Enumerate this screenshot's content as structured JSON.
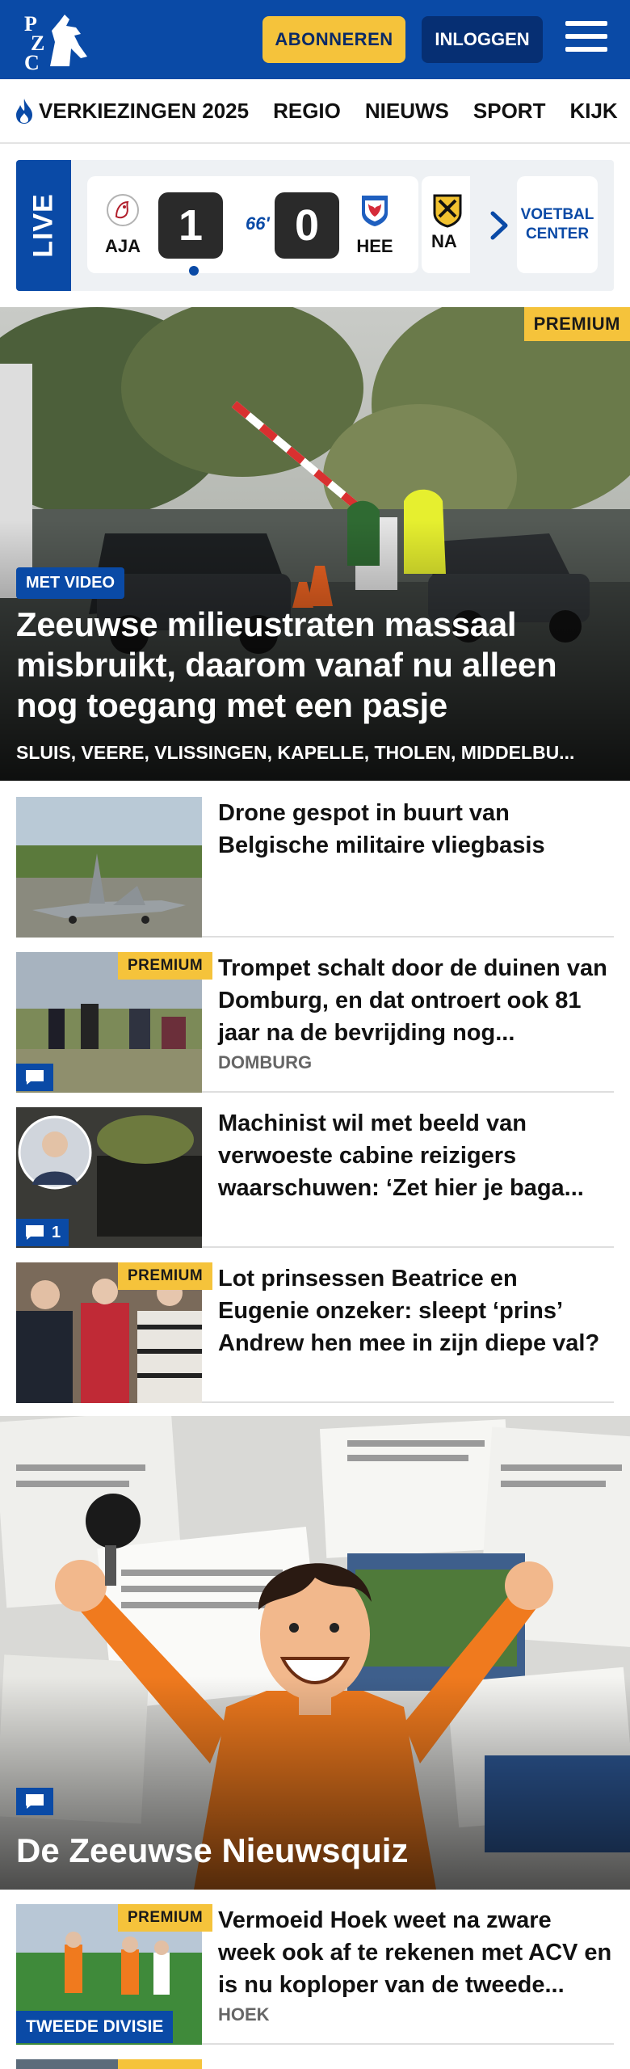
{
  "header": {
    "subscribe_label": "ABONNEREN",
    "login_label": "INLOGGEN",
    "logo_text": "PZC",
    "brand_color": "#0a4aa6",
    "accent_color": "#f5c33b"
  },
  "nav": {
    "items": [
      "VERKIEZINGEN 2025",
      "REGIO",
      "NIEUWS",
      "SPORT",
      "KIJK"
    ]
  },
  "live": {
    "label": "LIVE",
    "match": {
      "home": "AJA",
      "away": "HEE",
      "home_score": "1",
      "away_score": "0",
      "minute": "66'"
    },
    "next_team": "NA",
    "center_label_1": "VOETBAL",
    "center_label_2": "CENTER"
  },
  "hero": {
    "premium": "PREMIUM",
    "video_badge": "MET VIDEO",
    "title": "Zeeuwse milieustraten massaal misbruikt, daarom vanaf nu alleen nog toegang met een pasje",
    "tags": "SLUIS, VEERE, VLISSINGEN, KAPELLE, THOLEN, MIDDELBU..."
  },
  "articles": [
    {
      "title": "Drone gespot in buurt van Belgische militaire vliegbasis",
      "premium": "",
      "location": "",
      "comments": ""
    },
    {
      "title": "Trompet schalt door de duinen van Domburg, en dat ontroert ook 81 jaar na de bevrijding nog...",
      "premium": "PREMIUM",
      "location": "DOMBURG",
      "comments": ""
    },
    {
      "title": "Machinist wil met beeld van verwoeste cabine reizigers waarschuwen: ‘Zet hier je baga...",
      "premium": "",
      "location": "",
      "comments": "1"
    },
    {
      "title": "Lot prinsessen Beatrice en Eugenie onzeker: sleept ‘prins’ Andrew hen mee in zijn diepe val?",
      "premium": "PREMIUM",
      "location": "",
      "comments": ""
    }
  ],
  "quiz": {
    "title": "De Zeeuwse Nieuwsquiz"
  },
  "article_last": {
    "title": "Vermoeid Hoek weet na zware week ook af te rekenen met ACV en is nu koploper van de tweede...",
    "premium": "PREMIUM",
    "location": "HOEK",
    "division": "TWEEDE DIVISIE"
  },
  "article_partial": {
    "premium": "PREMIUM"
  }
}
